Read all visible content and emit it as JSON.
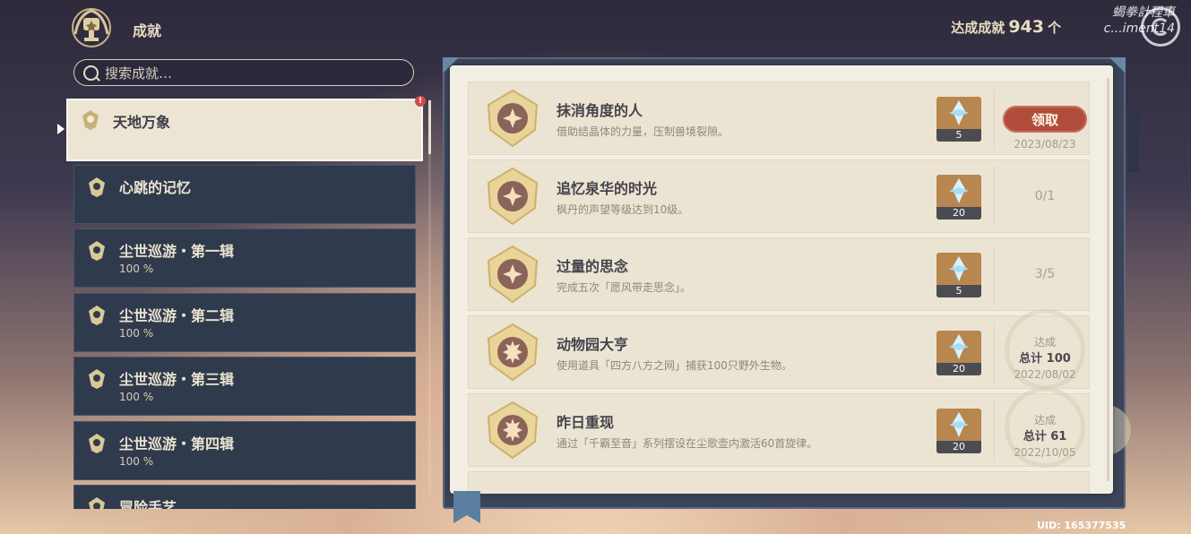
{
  "header": {
    "title": "成就",
    "count_label": "达成成就",
    "count_value": "943",
    "count_unit": "个"
  },
  "watermark": {
    "line1": "蝎拳計程車",
    "line2": "c...iment14"
  },
  "search": {
    "placeholder": "搜索成就…"
  },
  "categories": [
    {
      "name": "天地万象",
      "percent": "",
      "selected": true
    },
    {
      "name": "心跳的记忆",
      "percent": ""
    },
    {
      "name": "尘世巡游・第一辑",
      "percent": "100 %"
    },
    {
      "name": "尘世巡游・第二辑",
      "percent": "100 %"
    },
    {
      "name": "尘世巡游・第三辑",
      "percent": "100 %"
    },
    {
      "name": "尘世巡游・第四辑",
      "percent": "100 %"
    },
    {
      "name": "冒险手艺",
      "percent": ""
    }
  ],
  "category_alert": "!",
  "achievements": [
    {
      "title": "抹消角度的人",
      "desc": "借助结晶体的力量，压制兽境裂隙。",
      "reward_qty": "5",
      "claim_label": "领取",
      "date": "2023/08/23"
    },
    {
      "title": "追忆泉华的时光",
      "desc": "枫丹的声望等级达到10级。",
      "reward_qty": "20",
      "progress": "0/1"
    },
    {
      "title": "过量的思念",
      "desc": "完成五次「愿风带走思念」。",
      "reward_qty": "5",
      "progress": "3/5"
    },
    {
      "title": "动物园大亨",
      "desc": "使用道具「四方八方之网」捕获100只野外生物。",
      "reward_qty": "20",
      "status": "达成",
      "total": "总计 100",
      "date": "2022/08/02"
    },
    {
      "title": "昨日重现",
      "desc": "通过「千霸至音」系列摆设在尘歌壶内激活60首旋律。",
      "reward_qty": "20",
      "status": "达成",
      "total": "总计 61",
      "date": "2022/10/05"
    }
  ],
  "footer": {
    "uid": "UID: 165377535"
  },
  "colors": {
    "claim_button": "#b14d3c",
    "panel_bg": "#f3eee3",
    "category_bg": "#2f3a4d"
  }
}
